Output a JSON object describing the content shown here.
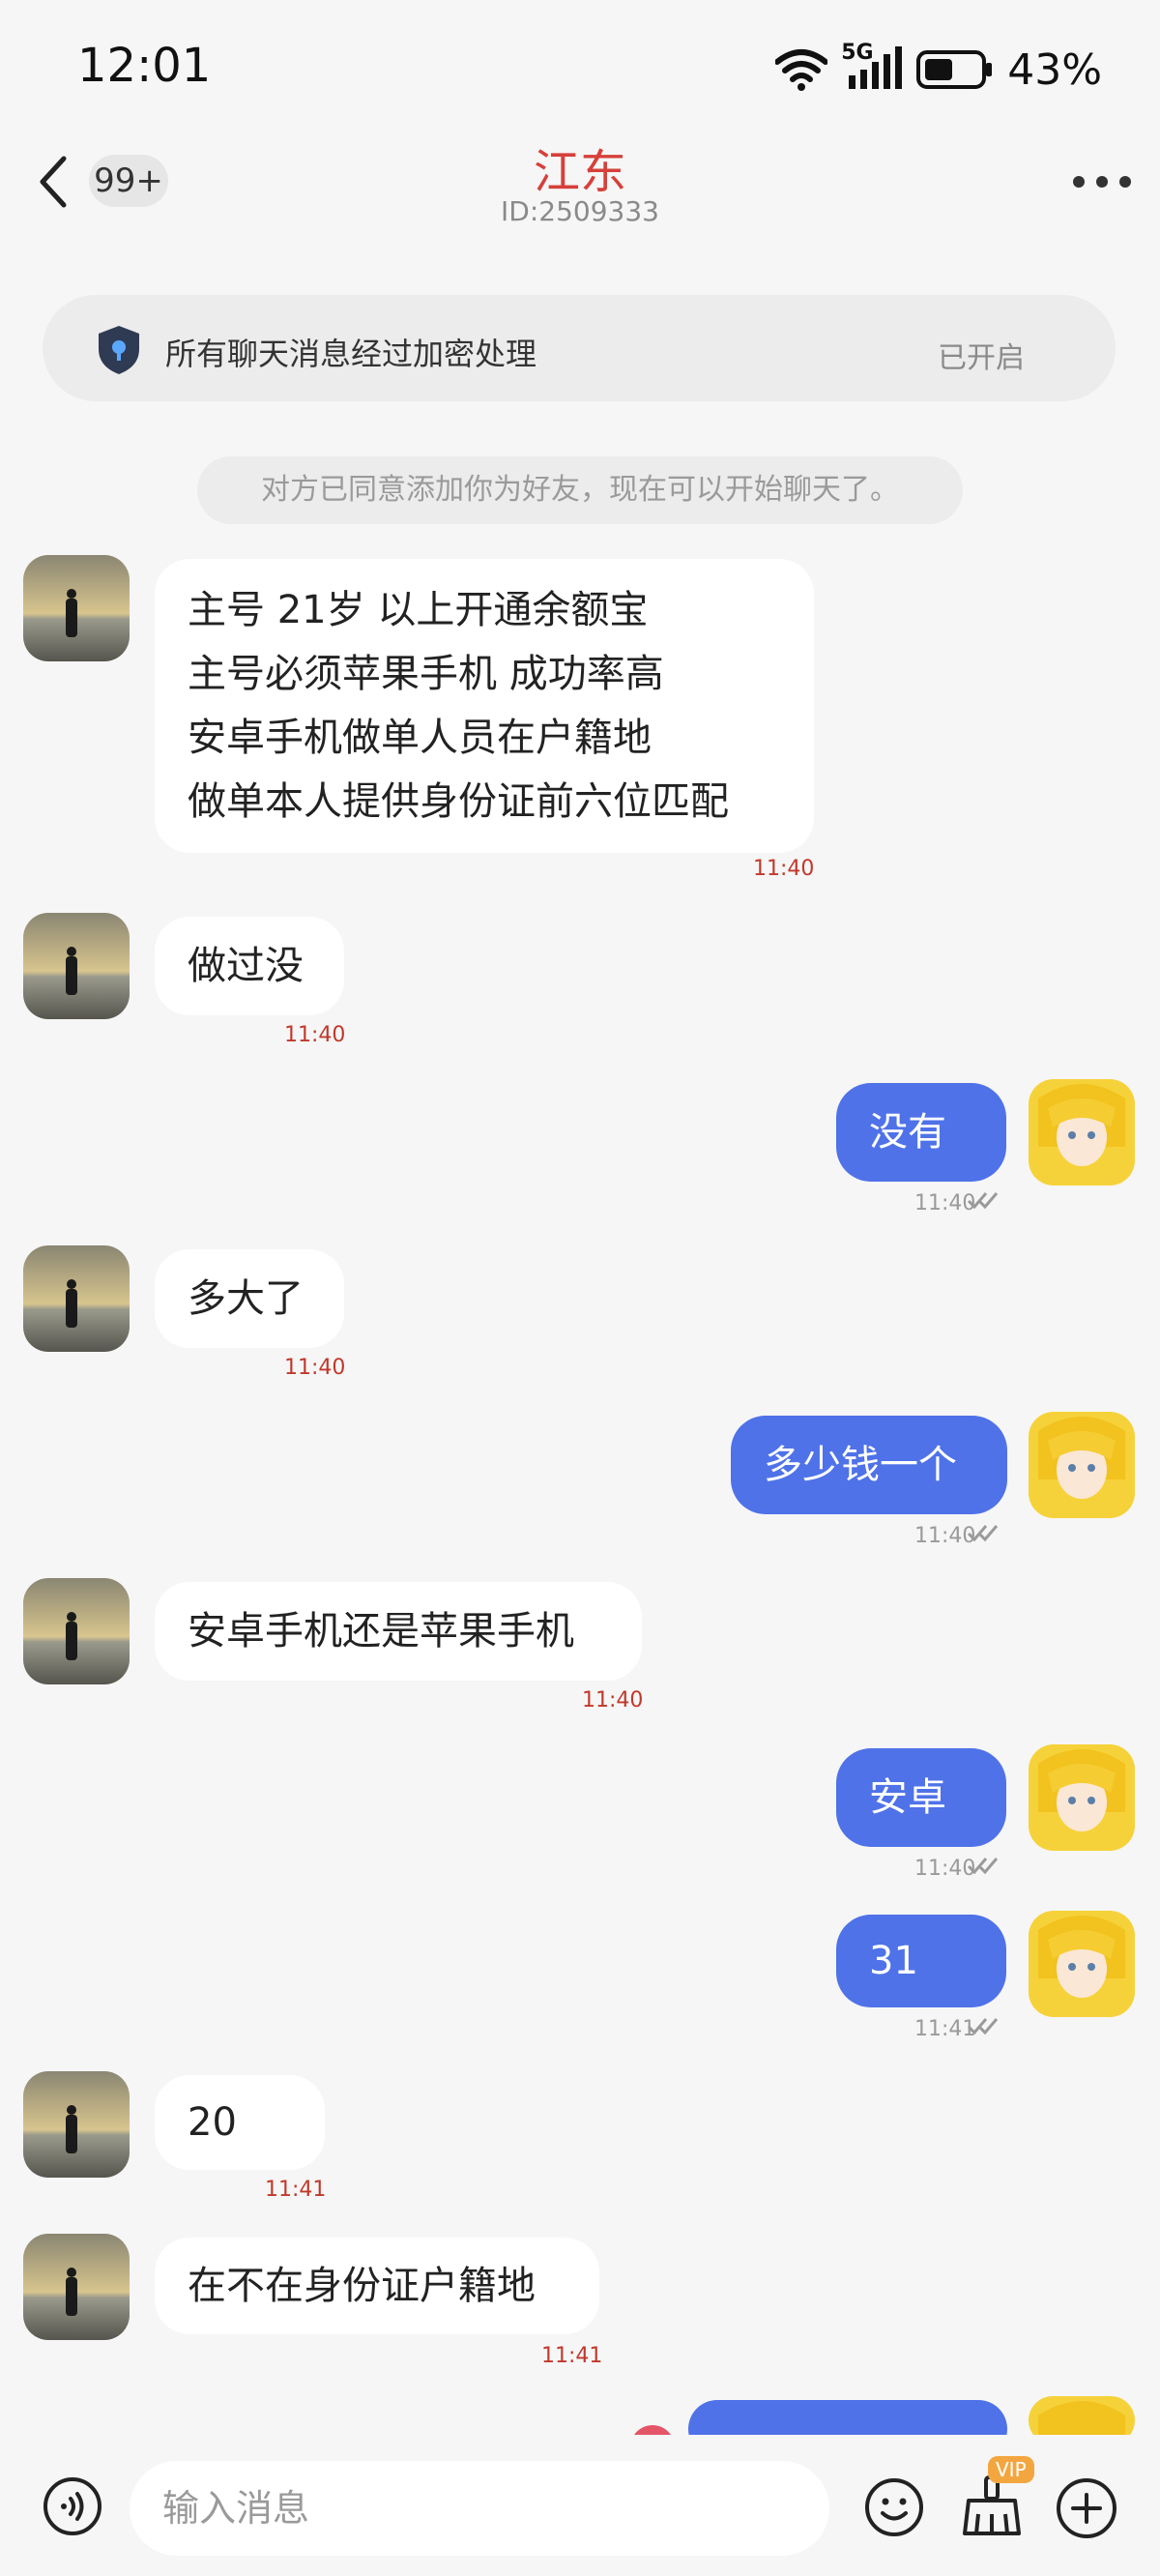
{
  "status_bar": {
    "time": "12:01",
    "network": "5G",
    "battery": "43%",
    "icons": [
      "wifi-icon",
      "signal-icon",
      "battery-icon"
    ]
  },
  "header": {
    "unread_badge": "99+",
    "title": "江东",
    "id_text": "ID:2509333",
    "icons": [
      "back-arrow-icon",
      "more-dots-icon"
    ]
  },
  "encryption": {
    "text": "所有聊天消息经过加密处理",
    "state": "已开启",
    "icon": "shield-icon"
  },
  "system_notice": "对方已同意添加你为好友，现在可以开始聊天了。",
  "messages": [
    {
      "side": "in",
      "lines": [
        "主号 21岁 以上开通余额宝",
        "主号必须苹果手机 成功率高",
        "安卓手机做单人员在户籍地",
        "做单本人提供身份证前六位匹配"
      ],
      "time": "11:40"
    },
    {
      "side": "in",
      "text": "做过没",
      "time": "11:40"
    },
    {
      "side": "out",
      "text": "没有",
      "time": "11:40"
    },
    {
      "side": "in",
      "text": "多大了",
      "time": "11:40"
    },
    {
      "side": "out",
      "text": "多少钱一个",
      "time": "11:40"
    },
    {
      "side": "in",
      "text": "安卓手机还是苹果手机",
      "time": "11:40"
    },
    {
      "side": "out",
      "text": "安卓",
      "time": "11:40"
    },
    {
      "side": "out",
      "text": "31",
      "time": "11:41"
    },
    {
      "side": "in",
      "text": "20",
      "time": "11:41"
    },
    {
      "side": "in",
      "text": "在不在身份证户籍地",
      "time": "11:41"
    }
  ],
  "input": {
    "placeholder": "输入消息",
    "vip_badge": "VIP",
    "icons": [
      "voice-icon",
      "emoji-icon",
      "clean-brush-icon",
      "plus-icon"
    ]
  },
  "colors": {
    "title": "#d6403a",
    "outgoing_bubble": "#4f72e8",
    "incoming_bubble": "#ffffff",
    "timestamp_incoming": "#c0392b",
    "background": "#f6f6f6"
  }
}
